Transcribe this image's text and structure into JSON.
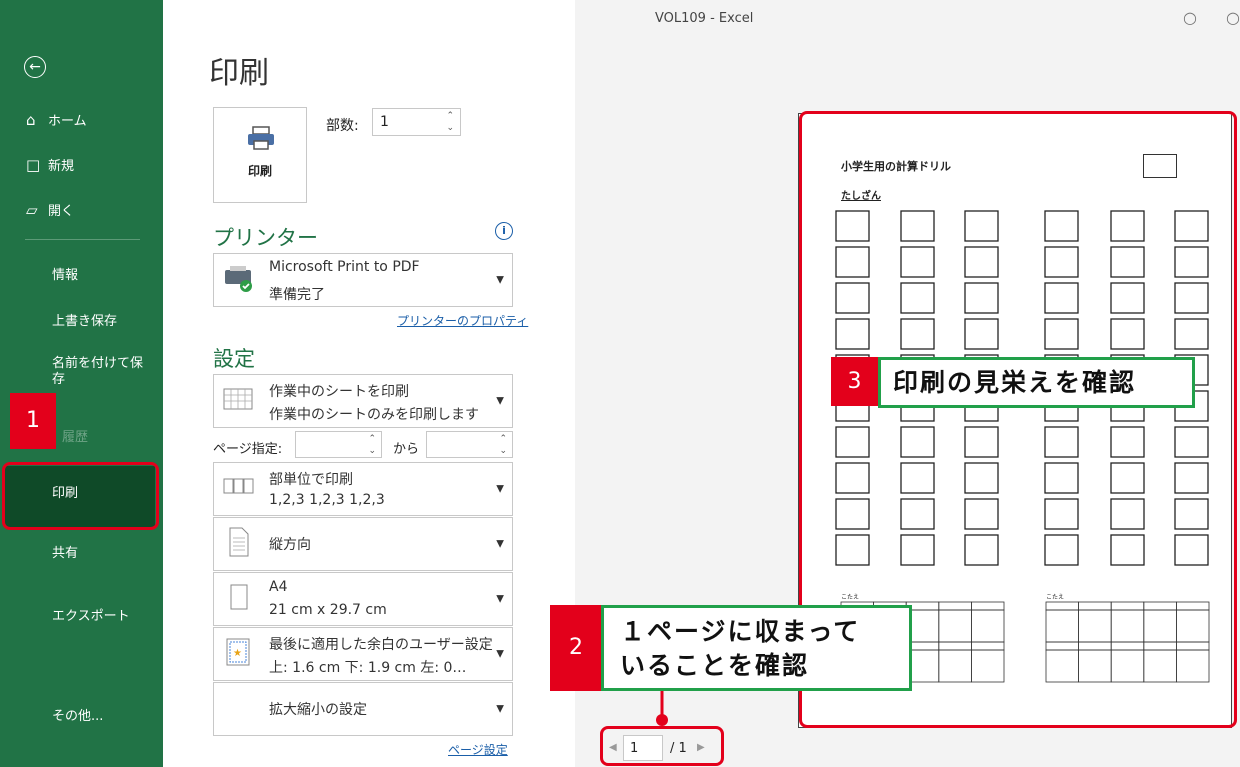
{
  "window": {
    "title": "VOL109  -  Excel"
  },
  "sidebar": {
    "back_icon": "back-arrow-icon",
    "items": [
      {
        "label": "ホーム",
        "icon": "home-icon"
      },
      {
        "label": "新規",
        "icon": "new-file-icon"
      },
      {
        "label": "開く",
        "icon": "folder-open-icon"
      },
      {
        "label": "情報"
      },
      {
        "label": "上書き保存"
      },
      {
        "label": "名前を付けて保存"
      },
      {
        "label": "履歴"
      },
      {
        "label": "印刷"
      },
      {
        "label": "共有"
      },
      {
        "label": "エクスポート"
      },
      {
        "label": "その他..."
      }
    ]
  },
  "print": {
    "heading": "印刷",
    "print_button_label": "印刷",
    "copies_label": "部数:",
    "copies_value": "1"
  },
  "printer": {
    "heading": "プリンター",
    "name": "Microsoft Print to PDF",
    "status": "準備完了",
    "properties_link": "プリンターのプロパティ"
  },
  "settings": {
    "heading": "設定",
    "sheet_l1": "作業中のシートを印刷",
    "sheet_l2": "作業中のシートのみを印刷します",
    "pages_label": "ページ指定:",
    "pages_to_label": "から",
    "collate_l1": "部単位で印刷",
    "collate_l2": "1,2,3    1,2,3    1,2,3",
    "orientation": "縦方向",
    "paper_l1": "A4",
    "paper_l2": "21 cm x 29.7 cm",
    "margins_l1": "最後に適用した余白のユーザー設定",
    "margins_l2": "上: 1.6 cm 下: 1.9 cm 左: 0…",
    "scaling": "拡大縮小の設定",
    "page_setup_link": "ページ設定"
  },
  "preview": {
    "sheet_title": "小学生用の計算ドリル",
    "sheet_subtitle": "たしざん",
    "answers_left": "こたえ",
    "answers_right": "こたえ",
    "current_page": "1",
    "total_pages": "/ 1"
  },
  "annotations": {
    "badge1": "1",
    "badge2": "2",
    "badge3": "3",
    "callout2": "１ページに収まって\nいることを確認",
    "callout3": "印刷の見栄えを確認"
  },
  "colors": {
    "excel_green": "#217346",
    "annotation_red": "#e3001b",
    "callout_green": "#21a04a"
  }
}
